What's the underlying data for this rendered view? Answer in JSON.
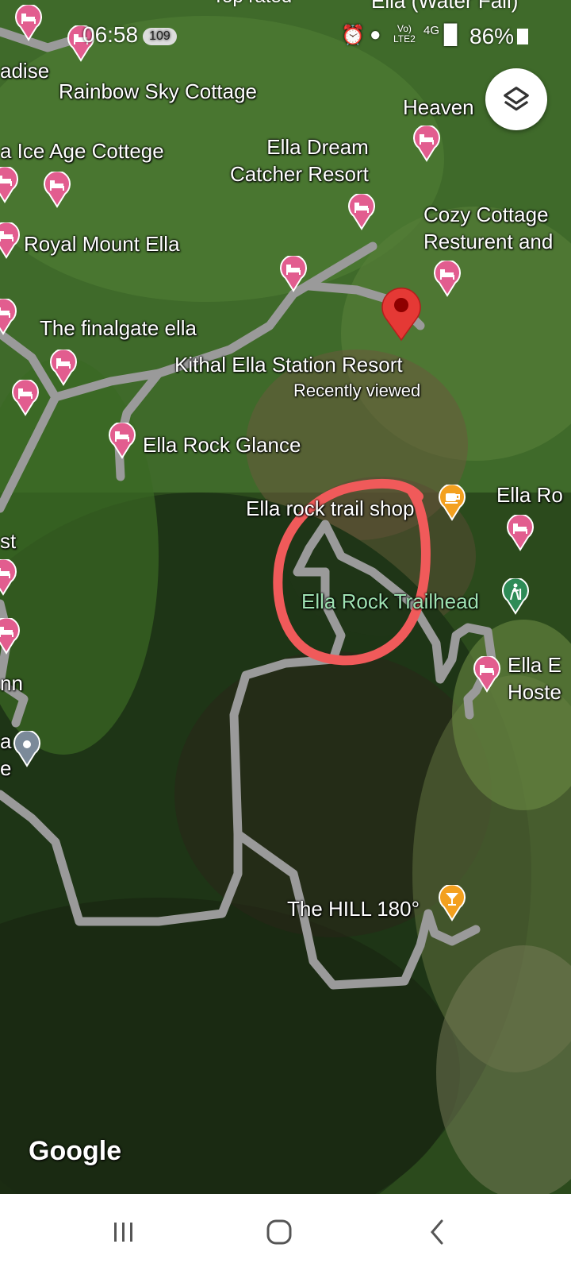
{
  "status_bar": {
    "time": "06:58",
    "notification_count": "109",
    "network_label_top": "Vo)",
    "network_label_bottom": "LTE2",
    "network_type": "4G",
    "battery": "86%",
    "top_cut_labels": [
      "Top rated",
      "Ella (Water Fall)"
    ]
  },
  "map": {
    "provider_logo": "Google",
    "labels": {
      "adise": "adise",
      "rainbow": "Rainbow Sky Cottage",
      "heaven": "Heaven",
      "ice_age": "a Ice Age Cottege",
      "dream_catcher": "Ella Dream\nCatcher Resort",
      "cozy": "Cozy Cottage\nResturent and",
      "royal_mount": "Royal Mount Ella",
      "finalgate": "The finalgate ella",
      "kithal": "Kithal Ella Station Resort",
      "recently_viewed": "Recently viewed",
      "rock_glance": "Ella Rock Glance",
      "trail_shop": "Ella rock trail shop",
      "ella_ro": "Ella Ro",
      "st": "st",
      "trailhead": "Ella Rock Trailhead",
      "ella_hostel": "Ella E\nHoste",
      "inn": "nn",
      "a_e": "a\ne",
      "hill180": "The HILL 180°"
    },
    "icons": {
      "hotel_pin": "hotel-pin-icon",
      "selected_pin": "red-location-pin-icon",
      "cafe_pin": "cafe-pin-icon",
      "trail_pin": "hiking-pin-icon",
      "bar_pin": "bar-pin-icon",
      "generic_pin": "place-pin-icon"
    },
    "colors": {
      "hotel_pin": "#e25d8f",
      "selected_pin": "#e53935",
      "cafe_pin": "#f3a01f",
      "trail_pin": "#2e8b57",
      "road": "#9a9a9a",
      "circle_annotation": "#f05a5a"
    }
  },
  "navigation_bar": {
    "recents": "recents-icon",
    "home": "home-icon",
    "back": "back-icon"
  }
}
